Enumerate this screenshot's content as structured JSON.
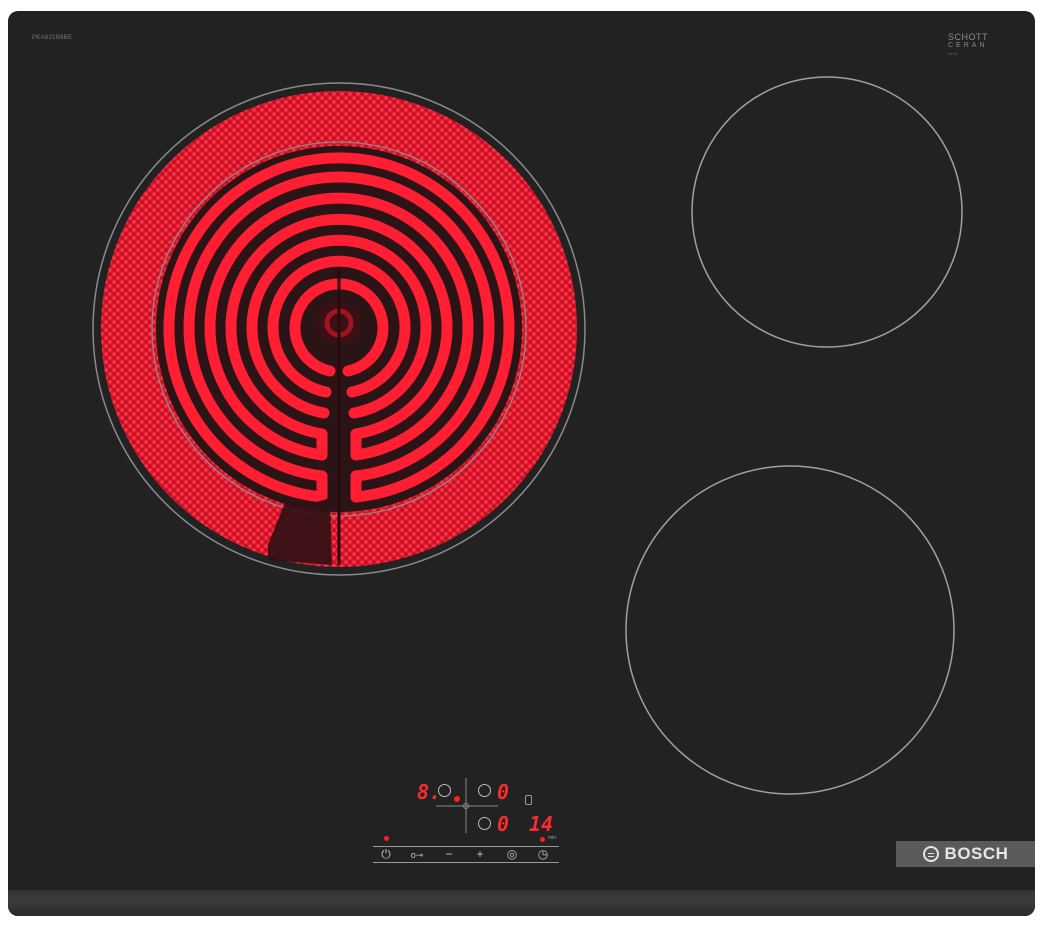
{
  "cooktop": {
    "model_code": "PKA631B8BE",
    "ceran_logo": {
      "line1": "SCHOTT",
      "line2": "CERAN",
      "line3": "serie"
    },
    "brand": "BOSCH",
    "colors": {
      "glass": "#222222",
      "heating_element": "#ff1a2a",
      "display": "#ff2a2a",
      "zone_outline": "#9a9a9a"
    }
  },
  "zones": [
    {
      "id": "zone-front-left",
      "state": "on",
      "dual_ring": true
    },
    {
      "id": "zone-rear-right",
      "state": "off"
    },
    {
      "id": "zone-front-right",
      "state": "off"
    }
  ],
  "display": {
    "left_level": "8.",
    "right_level_top": "0",
    "right_level_bottom": "0",
    "timer_value": "14",
    "timer_unit": "min"
  },
  "controls": [
    {
      "name": "power-button",
      "icon": "power-icon",
      "glyph": "⏻"
    },
    {
      "name": "child-lock-button",
      "icon": "key-icon",
      "glyph": "o⊸"
    },
    {
      "name": "minus-button",
      "icon": "minus-icon",
      "glyph": "−"
    },
    {
      "name": "plus-button",
      "icon": "plus-icon",
      "glyph": "+"
    },
    {
      "name": "dual-zone-button",
      "icon": "dual-ring-icon",
      "glyph": "◎"
    },
    {
      "name": "timer-button",
      "icon": "timer-icon",
      "glyph": "◷"
    }
  ]
}
